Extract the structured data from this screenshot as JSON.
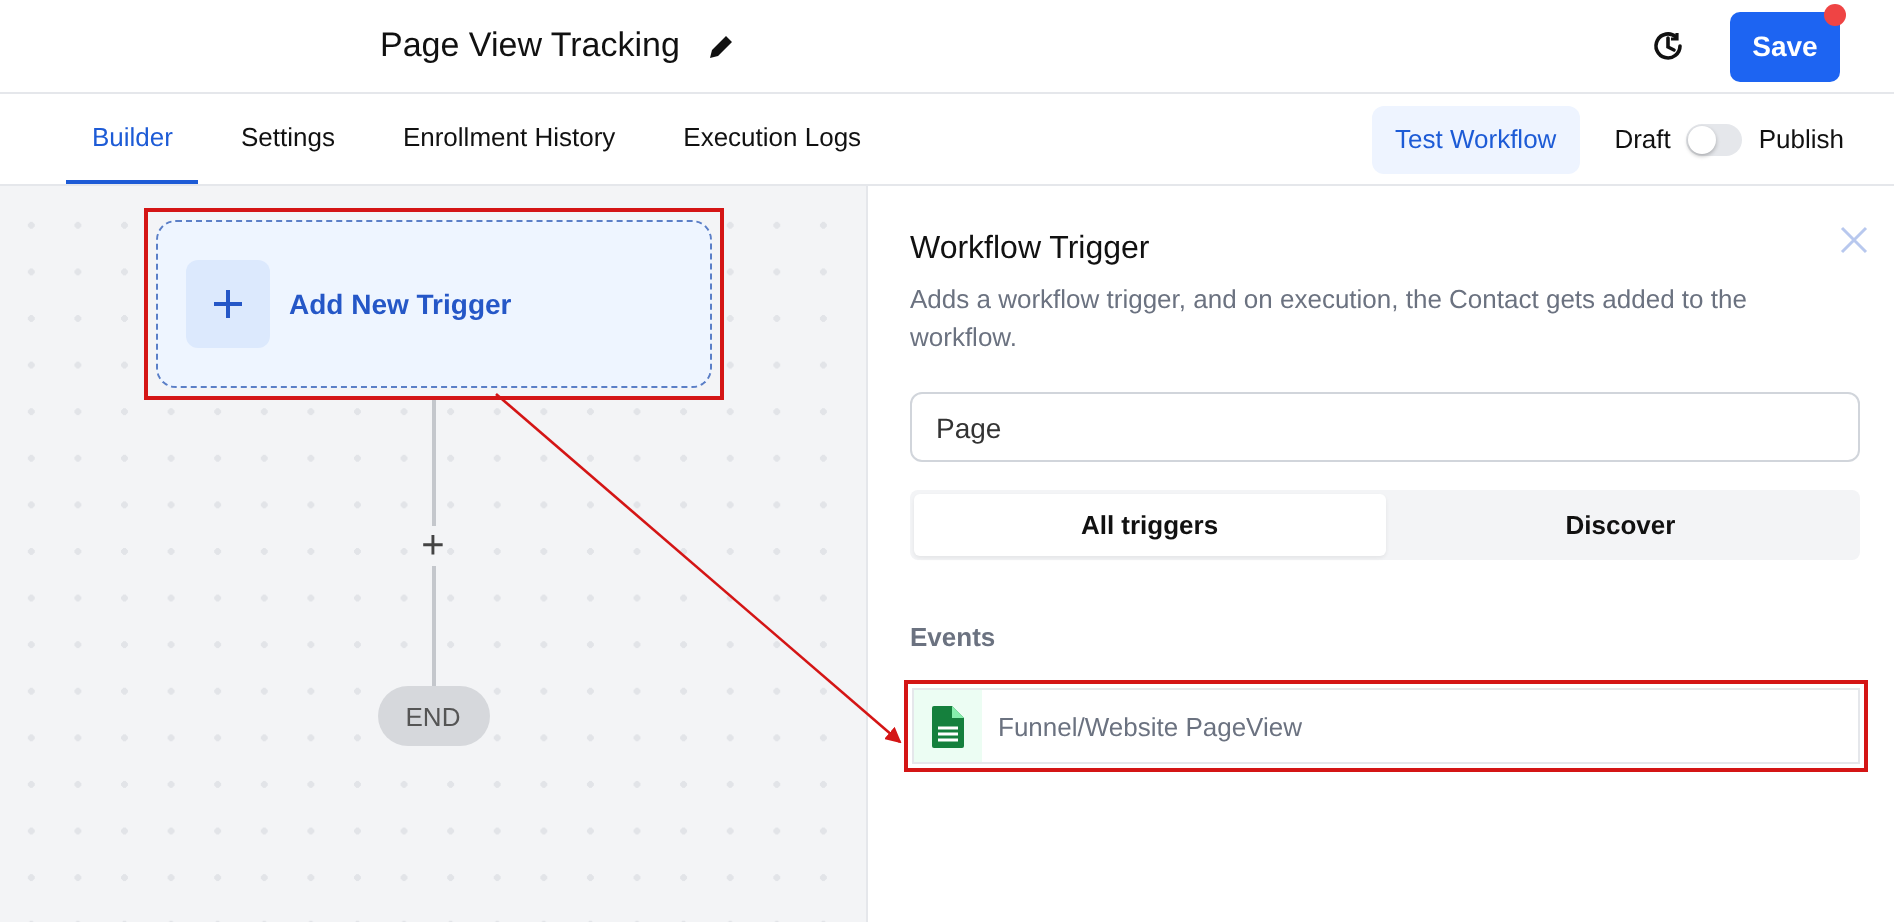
{
  "header": {
    "title": "Page View Tracking",
    "save_label": "Save",
    "save_notification": true
  },
  "tabs": [
    {
      "label": "Builder",
      "selected": true
    },
    {
      "label": "Settings",
      "selected": false
    },
    {
      "label": "Enrollment History",
      "selected": false
    },
    {
      "label": "Execution Logs",
      "selected": false
    }
  ],
  "test_button": "Test Workflow",
  "status_toggle": {
    "off_label": "Draft",
    "on_label": "Publish",
    "on": false
  },
  "canvas": {
    "trigger_node": {
      "label": "Add New Trigger",
      "highlighted": true
    },
    "add_step": "+",
    "end_label": "END",
    "annotation_arrow": true
  },
  "panel": {
    "title": "Workflow Trigger",
    "description": "Adds a workflow trigger, and on execution, the Contact gets added to the workflow.",
    "search": {
      "value": "Page"
    },
    "filters": [
      {
        "label": "All triggers",
        "selected": true
      },
      {
        "label": "Discover",
        "selected": false
      }
    ],
    "section": "Events",
    "events": [
      {
        "label": "Funnel/Website PageView",
        "highlighted": true
      }
    ]
  }
}
